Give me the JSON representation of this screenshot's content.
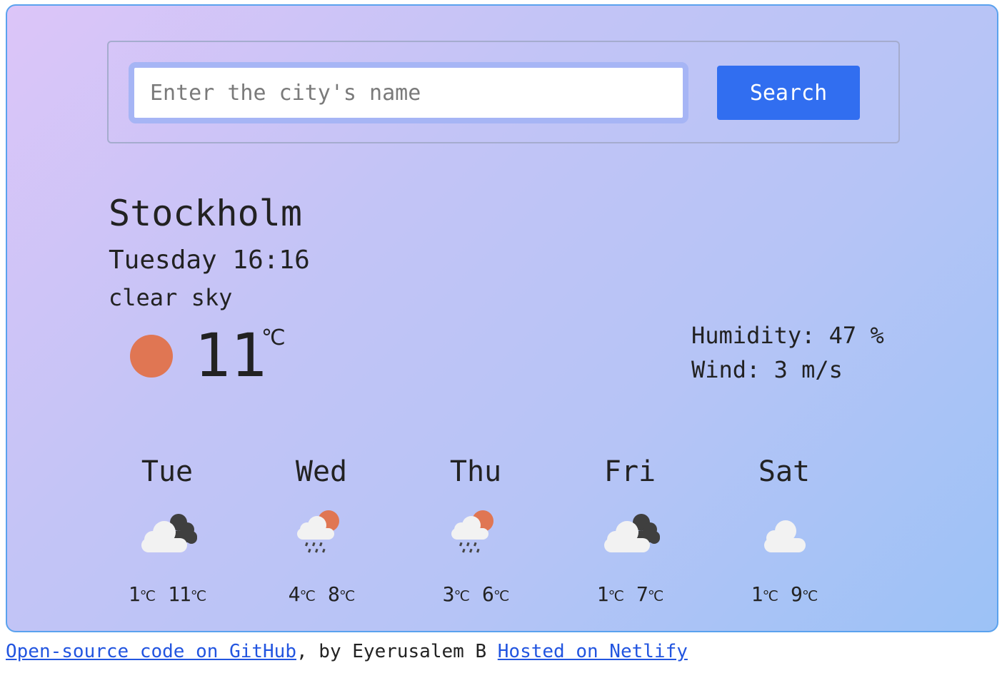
{
  "search": {
    "placeholder": "Enter the city's name",
    "value": "",
    "button_label": "Search"
  },
  "current": {
    "city": "Stockholm",
    "datetime": "Tuesday 16:16",
    "description": "clear sky",
    "icon": "sun-icon",
    "temperature": "11",
    "unit": "℃",
    "humidity_label": "Humidity: 47 %",
    "wind_label": "Wind: 3 m/s"
  },
  "forecast": [
    {
      "day": "Tue",
      "icon": "broken-clouds-icon",
      "min": "1",
      "max": "11",
      "unit": "℃"
    },
    {
      "day": "Wed",
      "icon": "rain-sun-icon",
      "min": "4",
      "max": "8",
      "unit": "℃"
    },
    {
      "day": "Thu",
      "icon": "rain-sun-icon",
      "min": "3",
      "max": "6",
      "unit": "℃"
    },
    {
      "day": "Fri",
      "icon": "broken-clouds-icon",
      "min": "1",
      "max": "7",
      "unit": "℃"
    },
    {
      "day": "Sat",
      "icon": "cloud-icon",
      "min": "1",
      "max": "9",
      "unit": "℃"
    }
  ],
  "footer": {
    "github_link": "Open-source code on GitHub",
    "author_text": ", by Eyerusalem B ",
    "netlify_link": "Hosted on Netlify"
  },
  "colors": {
    "accent": "#316ef0",
    "sun": "#e07653",
    "border": "#5aa2ee",
    "cloud_light": "#f2f2f2",
    "cloud_dark": "#3f3f3f"
  }
}
